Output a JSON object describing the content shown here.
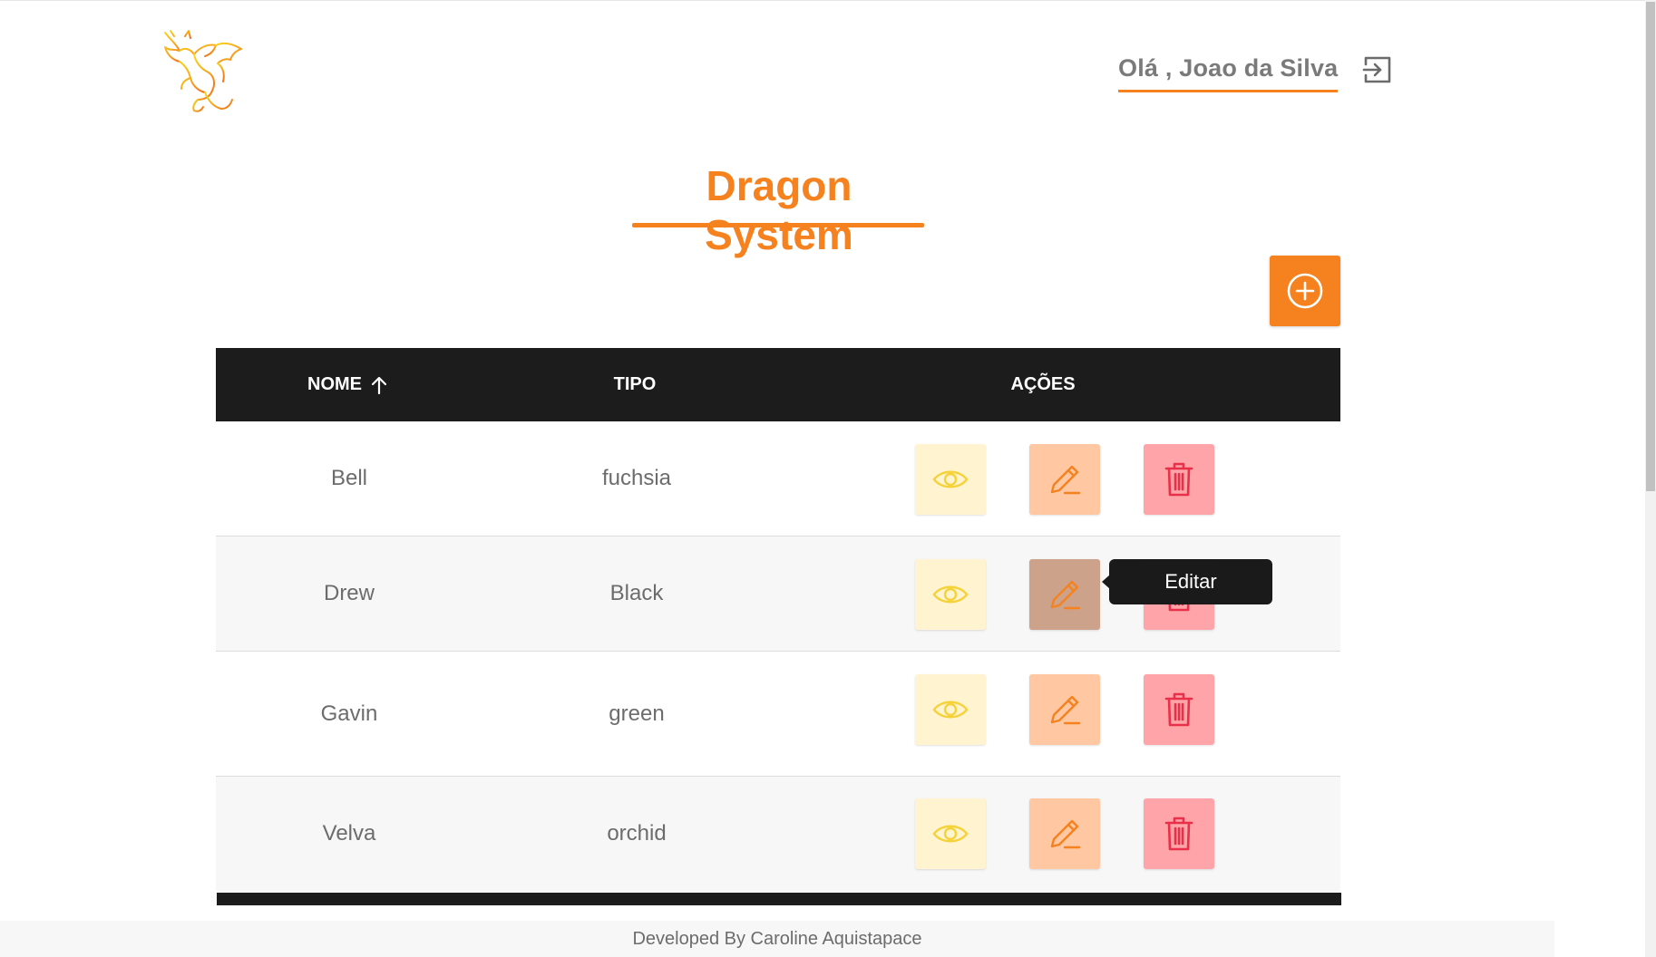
{
  "header": {
    "greeting": "Olá , Joao da Silva",
    "logo_icon": "dragon-logo-icon",
    "logout_icon": "logout-icon"
  },
  "page": {
    "title": "Dragon System",
    "add_icon": "plus-circle-icon"
  },
  "table": {
    "columns": {
      "nome": "NOME",
      "tipo": "TIPO",
      "acoes": "AÇÕES"
    },
    "sort": {
      "column": "nome",
      "direction": "asc",
      "icon": "arrow-up-icon"
    },
    "rows": [
      {
        "nome": "Bell",
        "tipo": "fuchsia"
      },
      {
        "nome": "Drew",
        "tipo": "Black"
      },
      {
        "nome": "Gavin",
        "tipo": "green"
      },
      {
        "nome": "Velva",
        "tipo": "orchid"
      }
    ],
    "actions": {
      "view_icon": "eye-icon",
      "edit_icon": "pencil-icon",
      "delete_icon": "trash-icon"
    }
  },
  "tooltip": {
    "text": "Editar"
  },
  "footer": {
    "text": "Developed By Caroline Aquistapace"
  },
  "colors": {
    "accent": "#f5821f",
    "header_dark": "#1c1c1c",
    "view_bg": "#fff4cf",
    "edit_bg": "#ffc8a3",
    "delete_bg": "#ffa4a8"
  }
}
